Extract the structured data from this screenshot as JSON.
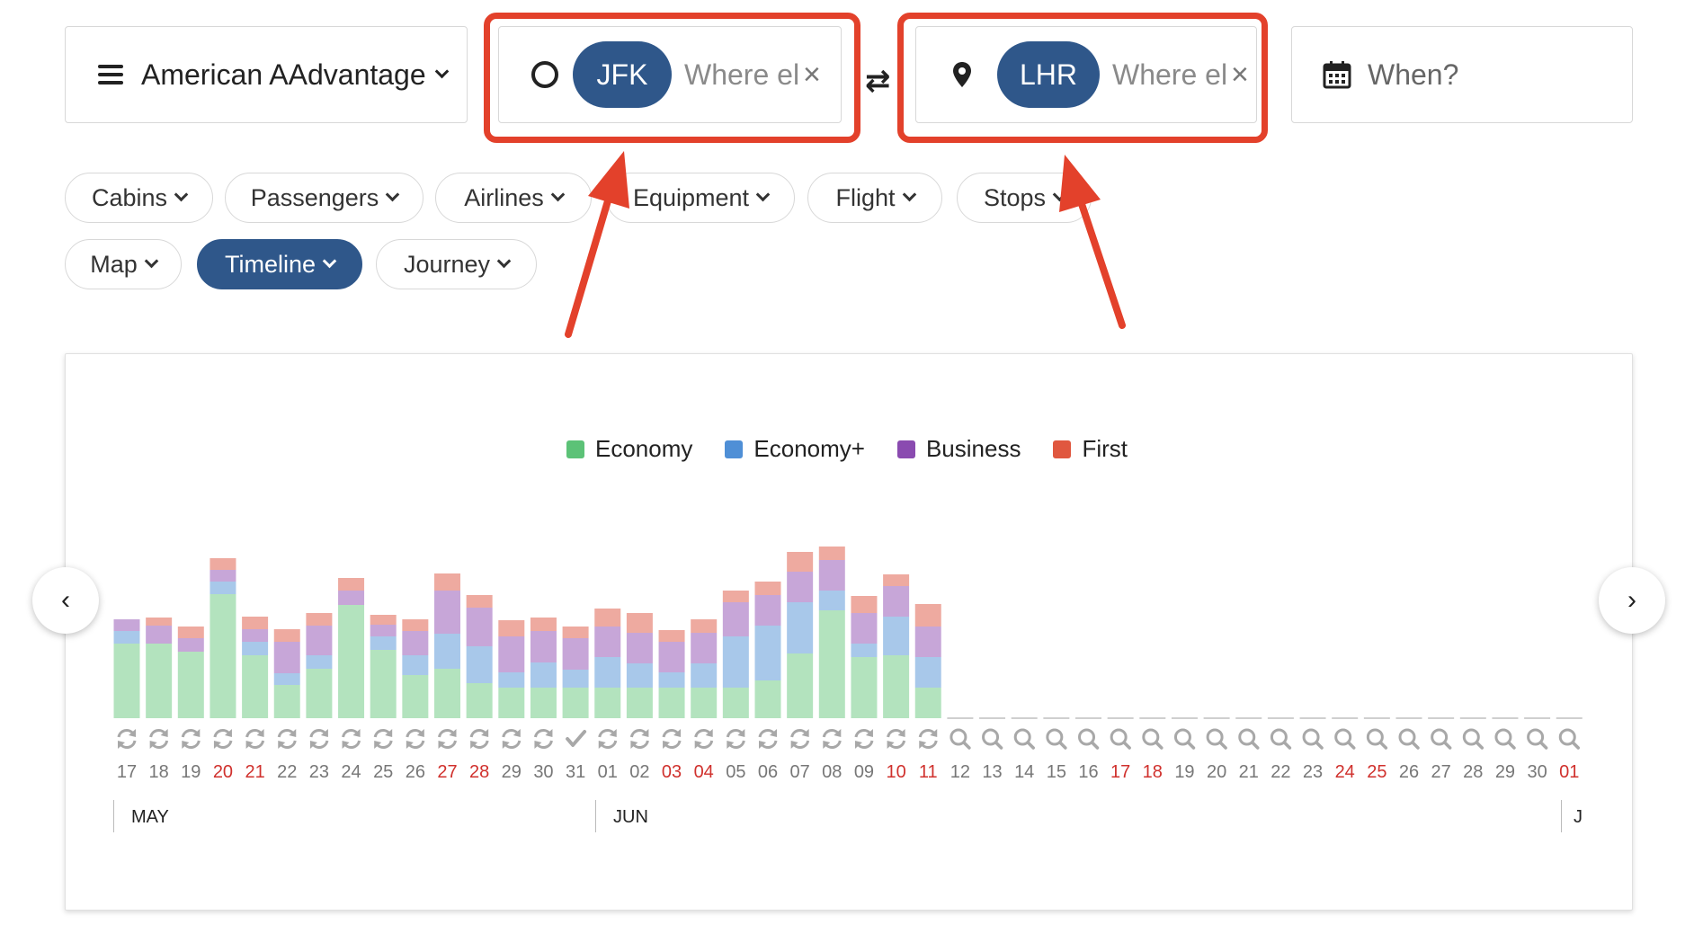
{
  "search": {
    "program": "American AAdvantage",
    "origin_code": "JFK",
    "origin_placeholder": "Where else?",
    "dest_code": "LHR",
    "dest_placeholder": "Where else?",
    "clear_glyph": "×",
    "swap_glyph": "⇄",
    "when_placeholder": "When?"
  },
  "filters": [
    {
      "label": "Cabins"
    },
    {
      "label": "Passengers"
    },
    {
      "label": "Airlines"
    },
    {
      "label": "Equipment"
    },
    {
      "label": "Flight"
    },
    {
      "label": "Stops"
    }
  ],
  "views": [
    {
      "label": "Map",
      "active": false
    },
    {
      "label": "Timeline",
      "active": true
    },
    {
      "label": "Journey",
      "active": false
    }
  ],
  "nav": {
    "prev": "‹",
    "next": "›"
  },
  "colors": {
    "accent": "#2f578a",
    "highlight": "#e3412b",
    "weekend_red": "#d0312d",
    "economy": "#b3e3be",
    "economy_plus": "#a8c8ea",
    "business": "#c7a6d8",
    "first": "#eeaaa0"
  },
  "chart_data": {
    "type": "bar",
    "stacked": true,
    "legend": [
      "Economy",
      "Economy+",
      "Business",
      "First"
    ],
    "legend_colors": [
      "#5cc277",
      "#4f8fd6",
      "#8a4bb0",
      "#e0573f"
    ],
    "months": [
      "MAY",
      "JUN",
      "J"
    ],
    "days": [
      "17",
      "18",
      "19",
      "20",
      "21",
      "22",
      "23",
      "24",
      "25",
      "26",
      "27",
      "28",
      "29",
      "30",
      "31",
      "01",
      "02",
      "03",
      "04",
      "05",
      "06",
      "07",
      "08",
      "09",
      "10",
      "11",
      "12",
      "13",
      "14",
      "15",
      "16",
      "17",
      "18",
      "19",
      "20",
      "21",
      "22",
      "23",
      "24",
      "25",
      "26",
      "27",
      "28",
      "29",
      "30",
      "01"
    ],
    "weekend": [
      false,
      false,
      false,
      true,
      true,
      false,
      false,
      false,
      false,
      false,
      true,
      true,
      false,
      false,
      false,
      false,
      false,
      true,
      true,
      false,
      false,
      false,
      false,
      false,
      true,
      true,
      false,
      false,
      false,
      false,
      false,
      true,
      true,
      false,
      false,
      false,
      false,
      false,
      true,
      true,
      false,
      false,
      false,
      false,
      false,
      true
    ],
    "status": [
      "refresh",
      "refresh",
      "refresh",
      "refresh",
      "refresh",
      "refresh",
      "refresh",
      "refresh",
      "refresh",
      "refresh",
      "refresh",
      "refresh",
      "refresh",
      "refresh",
      "check",
      "refresh",
      "refresh",
      "refresh",
      "refresh",
      "refresh",
      "refresh",
      "refresh",
      "refresh",
      "refresh",
      "refresh",
      "refresh",
      "search",
      "search",
      "search",
      "search",
      "search",
      "search",
      "search",
      "search",
      "search",
      "search",
      "search",
      "search",
      "search",
      "search",
      "search",
      "search",
      "search",
      "search",
      "search",
      "search"
    ],
    "series": [
      {
        "name": "Economy",
        "values": [
          83,
          83,
          74,
          138,
          70,
          37,
          55,
          126,
          76,
          48,
          55,
          39,
          34,
          34,
          34,
          34,
          34,
          34,
          34,
          34,
          42,
          72,
          120,
          68,
          70,
          34
        ]
      },
      {
        "name": "Economy+",
        "values": [
          14,
          0,
          0,
          14,
          15,
          13,
          15,
          0,
          15,
          22,
          39,
          41,
          17,
          28,
          20,
          34,
          27,
          17,
          27,
          57,
          61,
          57,
          22,
          15,
          43,
          34
        ]
      },
      {
        "name": "Business",
        "values": [
          13,
          20,
          15,
          13,
          14,
          35,
          33,
          16,
          13,
          27,
          48,
          43,
          40,
          35,
          35,
          34,
          34,
          34,
          34,
          38,
          34,
          34,
          34,
          34,
          34,
          34
        ]
      },
      {
        "name": "First",
        "values": [
          0,
          9,
          13,
          13,
          14,
          14,
          14,
          14,
          11,
          13,
          19,
          14,
          18,
          15,
          13,
          20,
          22,
          13,
          15,
          13,
          15,
          22,
          15,
          19,
          13,
          25
        ]
      }
    ]
  }
}
